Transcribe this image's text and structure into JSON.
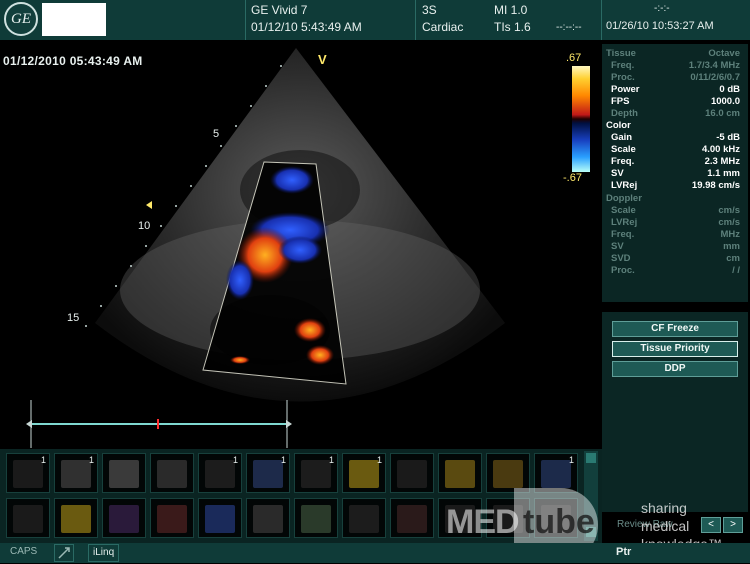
{
  "header": {
    "system": "GE Vivid 7",
    "exam_datetime": "01/12/10 5:43:49 AM",
    "probe": "3S",
    "application": "Cardiac",
    "mi": "MI 1.0",
    "tis": "TIs 1.6",
    "frame_indicator": "--:--:--",
    "clock_top": "-:-:-",
    "clock": "01/26/10 10:53:27 AM"
  },
  "image": {
    "date_stamp": "01/12/2010 05:43:49 AM",
    "orientation_mark": "V",
    "depth_markers": [
      "5",
      "10",
      "15"
    ],
    "colorbar": {
      "top": ".67",
      "bottom": "-.67"
    }
  },
  "params": {
    "tissue": {
      "label": "Tissue",
      "mode": "Octave",
      "rows": [
        {
          "label": "Freq.",
          "value": "1.7/3.4 MHz",
          "state": "dim"
        },
        {
          "label": "Proc.",
          "value": "0/11/2/6/0.7",
          "state": "dim"
        },
        {
          "label": "Power",
          "value": "0  dB",
          "state": "active"
        },
        {
          "label": "FPS",
          "value": "1000.0",
          "state": "active"
        },
        {
          "label": "Depth",
          "value": "16.0  cm",
          "state": "dim"
        }
      ]
    },
    "color": {
      "label": "Color",
      "rows": [
        {
          "label": "Gain",
          "value": "-5  dB",
          "state": "active"
        },
        {
          "label": "Scale",
          "value": "4.00  kHz",
          "state": "active"
        },
        {
          "label": "Freq.",
          "value": "2.3  MHz",
          "state": "active"
        },
        {
          "label": "SV",
          "value": "1.1  mm",
          "state": "active"
        },
        {
          "label": "LVRej",
          "value": "19.98  cm/s",
          "state": "active"
        }
      ]
    },
    "doppler": {
      "label": "Doppler",
      "rows": [
        {
          "label": "Scale",
          "value": "cm/s",
          "state": "dim"
        },
        {
          "label": "LVRej",
          "value": "cm/s",
          "state": "dim"
        },
        {
          "label": "Freq.",
          "value": "MHz",
          "state": "dim"
        },
        {
          "label": "SV",
          "value": "mm",
          "state": "dim"
        },
        {
          "label": "SVD",
          "value": "cm",
          "state": "dim"
        },
        {
          "label": "Proc.",
          "value": "/ /",
          "state": "dim"
        }
      ]
    }
  },
  "buttons": {
    "cf_freeze": "CF Freeze",
    "tissue_priority": "Tissue Priority",
    "ddp": "DDP",
    "review_label": "Review Raw",
    "prev": "<",
    "next": ">"
  },
  "thumbnails": {
    "row1": [
      "1",
      "1",
      "",
      "",
      "1",
      "1",
      "1",
      "1",
      "",
      "",
      "",
      "1"
    ],
    "row2": [
      "",
      "",
      "",
      "",
      "",
      "",
      "",
      "",
      "",
      "",
      "",
      ""
    ]
  },
  "footer": {
    "caps": "CAPS",
    "iling": "iLinq",
    "ptr": "Ptr"
  },
  "watermark": {
    "brand_left": "MED",
    "brand_right": "tube",
    "side": "sharing\nmedical\nknowledge™"
  },
  "colors": {
    "header_bg": "#0f3b38",
    "panel_bg": "#0b2624",
    "accent_yellow": "#ffe96a"
  }
}
